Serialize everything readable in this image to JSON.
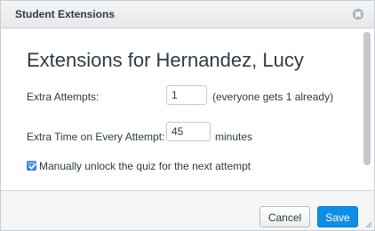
{
  "dialog": {
    "title": "Student Extensions"
  },
  "content": {
    "heading": "Extensions for Hernandez, Lucy",
    "extra_attempts": {
      "label": "Extra Attempts:",
      "value": "1",
      "note": "(everyone gets 1 already)"
    },
    "extra_time": {
      "label": "Extra Time on Every Attempt:",
      "value": "45",
      "unit": "minutes"
    },
    "manual_unlock": {
      "label": "Manually unlock the quiz for the next attempt",
      "checked": true
    }
  },
  "footer": {
    "cancel_label": "Cancel",
    "save_label": "Save"
  },
  "colors": {
    "primary_button": "#0f8ee6",
    "text": "#2d3b45",
    "checkbox": "#2f76d6"
  },
  "icons": [
    "close-icon",
    "checkmark-icon",
    "resize-grip-icon"
  ]
}
